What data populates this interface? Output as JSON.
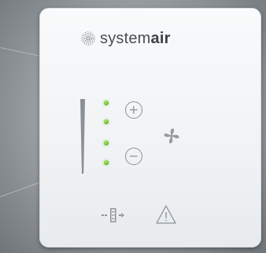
{
  "brand": {
    "name_prefix": "system",
    "name_suffix": "air",
    "logo_icon": "systemair-swirl-icon"
  },
  "fan_level": {
    "active_leds": 4,
    "total_leds": 4,
    "led_color": "#6fbf2a"
  },
  "controls": {
    "increase_icon": "plus-circle-icon",
    "decrease_icon": "minus-circle-icon",
    "fan_icon": "fan-icon",
    "filter_icon": "filter-icon",
    "alarm_icon": "warning-triangle-icon"
  },
  "colors": {
    "panel": "#f4f5f7",
    "icon_gray": "#8c9398",
    "logo_gray": "#4a4f54"
  }
}
